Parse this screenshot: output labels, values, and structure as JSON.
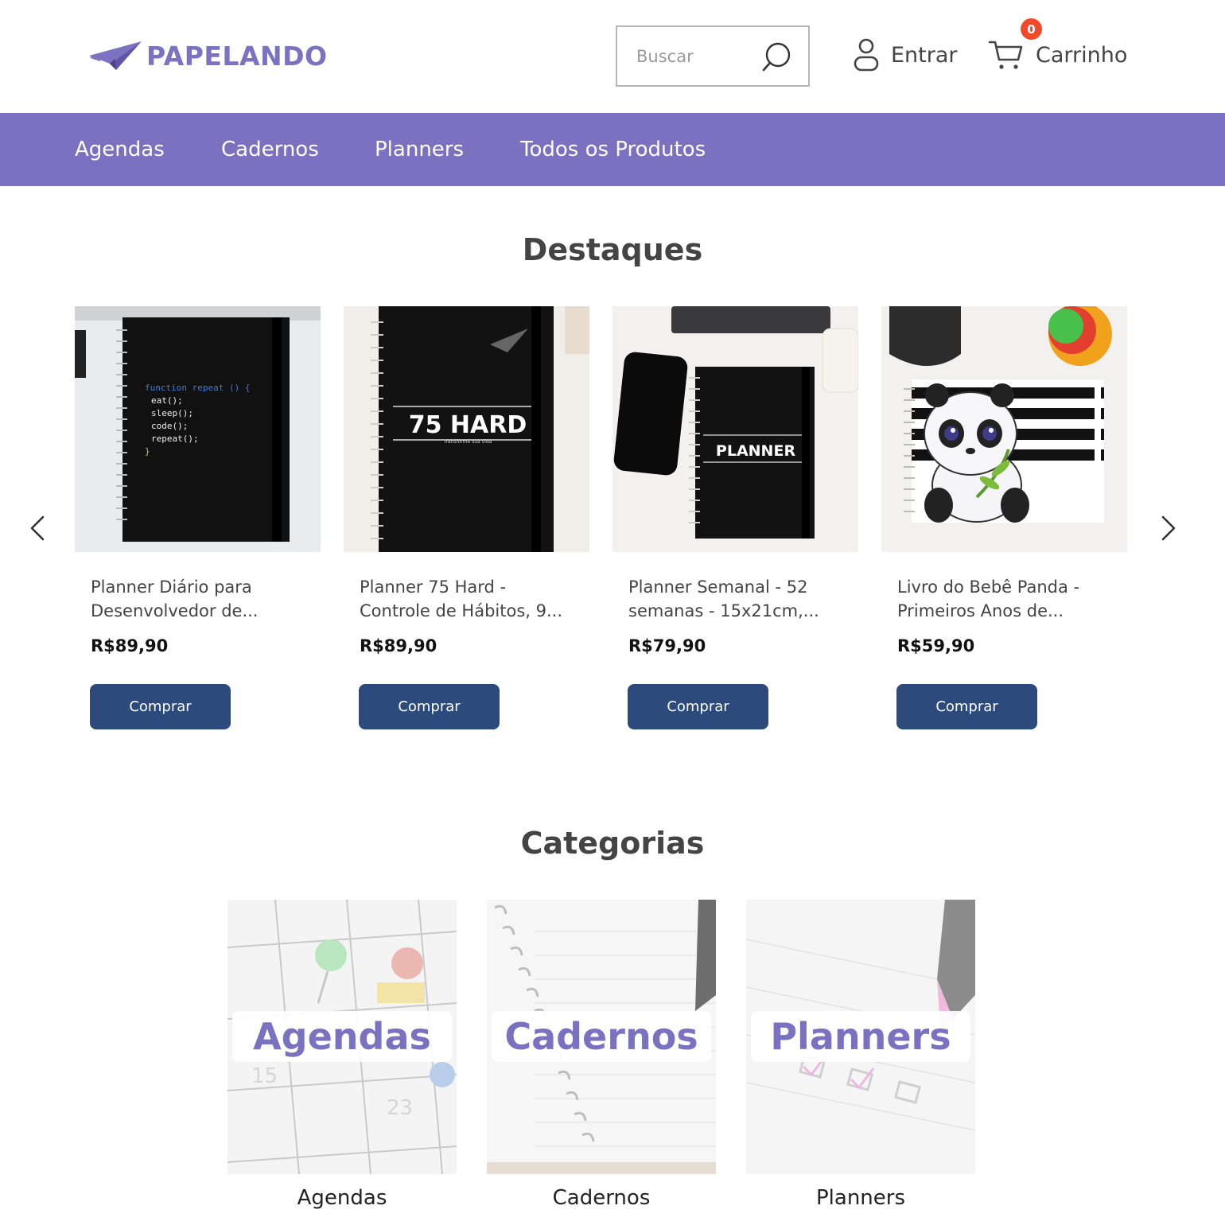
{
  "header": {
    "logo_text": "PAPELANDO",
    "search_placeholder": "Buscar",
    "login_label": "Entrar",
    "cart_label": "Carrinho",
    "cart_count": "0"
  },
  "nav": {
    "items": [
      {
        "label": "Agendas"
      },
      {
        "label": "Cadernos"
      },
      {
        "label": "Planners"
      },
      {
        "label": "Todos os Produtos"
      }
    ]
  },
  "featured": {
    "title": "Destaques",
    "products": [
      {
        "name_line1": "Planner Diário para",
        "name_line2": "Desenvolvedor de...",
        "price": "R$89,90",
        "buy_label": "Comprar",
        "cover_code": [
          "function repeat () {",
          "eat();",
          "sleep();",
          "code();",
          "repeat();",
          "}"
        ]
      },
      {
        "name_line1": "Planner 75 Hard -",
        "name_line2": "Controle de Hábitos, 9...",
        "price": "R$89,90",
        "buy_label": "Comprar",
        "cover_title": "75 HARD",
        "cover_subtitle": "Transforme sua vida"
      },
      {
        "name_line1": "Planner Semanal - 52",
        "name_line2": "semanas - 15x21cm,...",
        "price": "R$79,90",
        "buy_label": "Comprar",
        "cover_title": "PLANNER"
      },
      {
        "name_line1": "Livro do Bebê Panda -",
        "name_line2": "Primeiros Anos de...",
        "price": "R$59,90",
        "buy_label": "Comprar"
      }
    ]
  },
  "categories": {
    "title": "Categorias",
    "items": [
      {
        "overlay": "Agendas",
        "caption": "Agendas"
      },
      {
        "overlay": "Cadernos",
        "caption": "Cadernos"
      },
      {
        "overlay": "Planners",
        "caption": "Planners"
      }
    ]
  },
  "colors": {
    "brand": "#7a72c1",
    "button": "#2d4a7c",
    "badge": "#f04a2a"
  }
}
